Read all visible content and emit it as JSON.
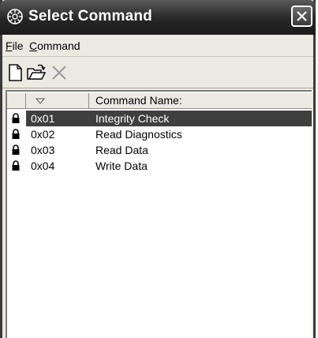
{
  "window": {
    "title": "Select Command",
    "icon": "gear-icon",
    "close_icon": "close-icon"
  },
  "menu": {
    "items": [
      {
        "mnemonic": "F",
        "rest": "ile"
      },
      {
        "mnemonic": "C",
        "rest": "ommand"
      }
    ]
  },
  "toolbar": {
    "buttons": [
      {
        "icon": "new-document-icon",
        "enabled": true
      },
      {
        "icon": "open-folder-icon",
        "enabled": true
      },
      {
        "icon": "delete-icon",
        "enabled": false
      }
    ]
  },
  "list": {
    "columns": [
      "",
      "",
      "Command Name:"
    ],
    "sort_icon": "sort-descending-icon",
    "row_icon": "lock-icon",
    "rows": [
      {
        "code": "0x01",
        "name": "Integrity Check",
        "selected": true
      },
      {
        "code": "0x02",
        "name": "Read Diagnostics",
        "selected": false
      },
      {
        "code": "0x03",
        "name": "Read Data",
        "selected": false
      },
      {
        "code": "0x04",
        "name": "Write Data",
        "selected": false
      }
    ]
  },
  "colors": {
    "titlebar": "#262626",
    "selection": "#3f3f3f",
    "chrome": "#ece9e3"
  }
}
